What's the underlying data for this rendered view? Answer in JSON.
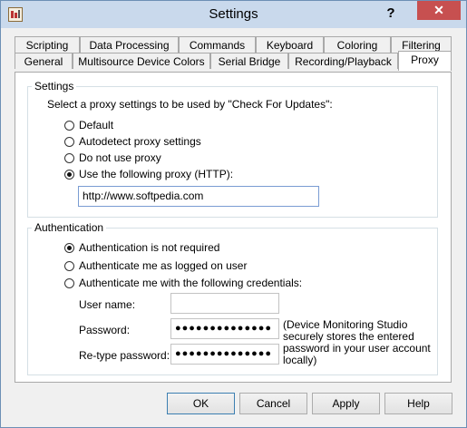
{
  "window": {
    "title": "Settings",
    "help_glyph": "?",
    "close_glyph": "✕"
  },
  "tabs_row1": [
    "Scripting",
    "Data Processing",
    "Commands",
    "Keyboard",
    "Coloring",
    "Filtering"
  ],
  "tabs_row2": [
    "General",
    "Multisource Device Colors",
    "Serial Bridge",
    "Recording/Playback",
    "Proxy"
  ],
  "active_tab": "Proxy",
  "settings": {
    "legend": "Settings",
    "prompt": "Select a proxy settings to be used by \"Check For Updates\":",
    "options": [
      "Default",
      "Autodetect proxy settings",
      "Do not use proxy",
      "Use the following proxy (HTTP):"
    ],
    "selected": "Use the following proxy (HTTP):",
    "proxy_value": "http://www.softpedia.com"
  },
  "auth": {
    "legend": "Authentication",
    "options": [
      "Authentication is not required",
      "Authenticate me as logged on user",
      "Authenticate me with the following credentials:"
    ],
    "selected": "Authentication is not required",
    "username_label": "User name:",
    "username_value": "",
    "password_label": "Password:",
    "password_value": "●●●●●●●●●●●●●●",
    "retype_label": "Re-type password:",
    "retype_value": "●●●●●●●●●●●●●●",
    "note": "(Device Monitoring Studio securely stores the entered password in your user account locally)"
  },
  "buttons": {
    "ok": "OK",
    "cancel": "Cancel",
    "apply": "Apply",
    "help": "Help"
  }
}
